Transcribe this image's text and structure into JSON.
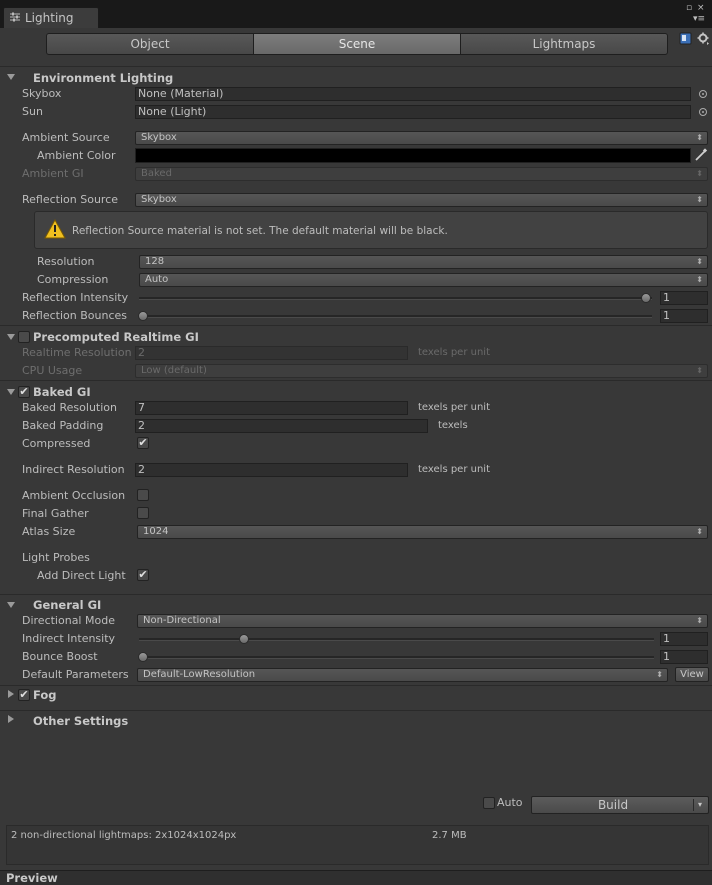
{
  "window": {
    "tab_title": "Lighting"
  },
  "tabs": [
    {
      "label": "Object"
    },
    {
      "label": "Scene"
    },
    {
      "label": "Lightmaps"
    }
  ],
  "environment": {
    "header": "Environment Lighting",
    "skybox_label": "Skybox",
    "skybox_value": "None (Material)",
    "sun_label": "Sun",
    "sun_value": "None (Light)",
    "ambient_source_label": "Ambient Source",
    "ambient_source_value": "Skybox",
    "ambient_color_label": "Ambient Color",
    "ambient_color": "#000000",
    "ambient_gi_label": "Ambient GI",
    "ambient_gi_value": "Baked",
    "reflection_source_label": "Reflection Source",
    "reflection_source_value": "Skybox",
    "warning_text": "Reflection Source material is not set. The default material will be black.",
    "resolution_label": "Resolution",
    "resolution_value": "128",
    "compression_label": "Compression",
    "compression_value": "Auto",
    "reflection_intensity_label": "Reflection Intensity",
    "reflection_intensity_value": "1",
    "reflection_intensity_level": 1.0,
    "reflection_bounces_label": "Reflection Bounces",
    "reflection_bounces_value": "1",
    "reflection_bounces_level": 0.0
  },
  "realtime_gi": {
    "header": "Precomputed Realtime GI",
    "enabled": false,
    "realtime_resolution_label": "Realtime Resolution",
    "realtime_resolution_value": "2",
    "unit": "texels per unit",
    "cpu_usage_label": "CPU Usage",
    "cpu_usage_value": "Low (default)"
  },
  "baked_gi": {
    "header": "Baked GI",
    "enabled": true,
    "baked_resolution_label": "Baked Resolution",
    "baked_resolution_value": "7",
    "baked_resolution_unit": "texels per unit",
    "baked_padding_label": "Baked Padding",
    "baked_padding_value": "2",
    "baked_padding_unit": "texels",
    "compressed_label": "Compressed",
    "compressed": true,
    "indirect_resolution_label": "Indirect Resolution",
    "indirect_resolution_value": "2",
    "indirect_resolution_unit": "texels per unit",
    "ambient_occlusion_label": "Ambient Occlusion",
    "ambient_occlusion": false,
    "final_gather_label": "Final Gather",
    "final_gather": false,
    "atlas_size_label": "Atlas Size",
    "atlas_size_value": "1024",
    "light_probes_label": "Light Probes",
    "add_direct_light_label": "Add Direct Light",
    "add_direct_light": true
  },
  "general_gi": {
    "header": "General GI",
    "directional_mode_label": "Directional Mode",
    "directional_mode_value": "Non-Directional",
    "indirect_intensity_label": "Indirect Intensity",
    "indirect_intensity_value": "1",
    "indirect_intensity_level": 0.2,
    "bounce_boost_label": "Bounce Boost",
    "bounce_boost_value": "1",
    "bounce_boost_level": 0.0,
    "default_parameters_label": "Default Parameters",
    "default_parameters_value": "Default-LowResolution",
    "view_button": "View"
  },
  "fog": {
    "header": "Fog",
    "enabled": true
  },
  "other_settings": {
    "header": "Other Settings"
  },
  "build": {
    "auto_label": "Auto",
    "auto": false,
    "build_label": "Build"
  },
  "stats": {
    "lightmaps_text": "2 non-directional lightmaps: 2x1024x1024px",
    "size_text": "2.7 MB"
  },
  "preview": {
    "label": "Preview"
  }
}
